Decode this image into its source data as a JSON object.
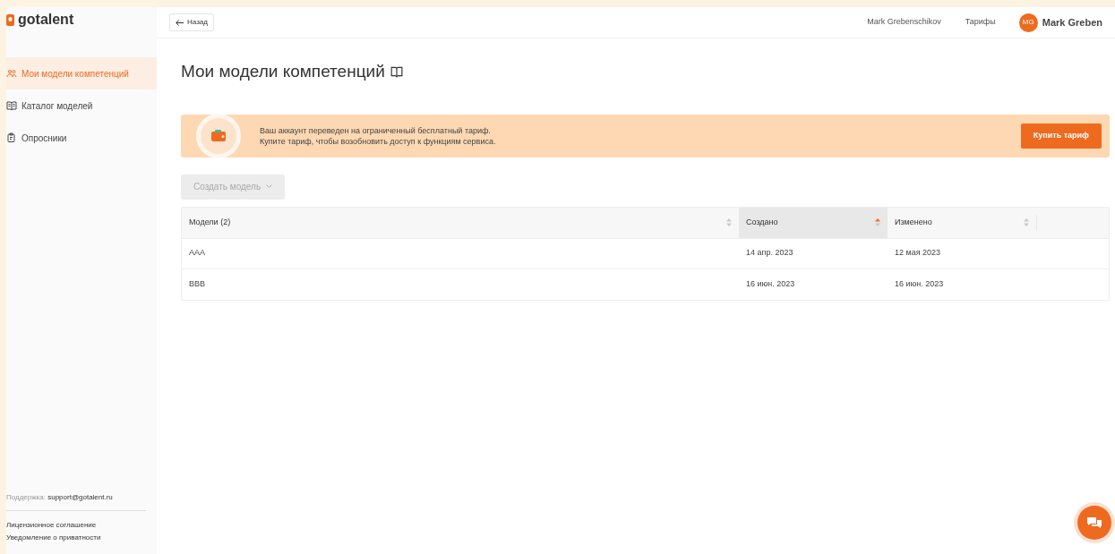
{
  "logo": {
    "text": "gotalent"
  },
  "sidebar": {
    "items": [
      {
        "label": "Мои модели компетенций",
        "selected": true,
        "kind": "people"
      },
      {
        "label": "Каталог моделей",
        "selected": false,
        "kind": "book"
      },
      {
        "label": "Опросники",
        "selected": false,
        "kind": "survey"
      }
    ],
    "support_label": "Поддержка:",
    "support_email": "support@gotalent.ru",
    "links": [
      "Лицензионное соглашение",
      "Уведомление о приватности"
    ]
  },
  "header": {
    "back": "Назад",
    "user_name": "Mark Grebenschikov",
    "tariffs": "Тарифы",
    "avatar_initials": "MG",
    "profile_name": "Mark Greben"
  },
  "page": {
    "title": "Мои модели компетенций"
  },
  "banner": {
    "lines": [
      "Ваш аккаунт переведен на ограниченный бесплатный тариф.",
      "Купите тариф, чтобы возобновить доступ к функциям сервиса."
    ],
    "button": "Купить тариф"
  },
  "create_button": {
    "label": "Создать модель",
    "disabled": true
  },
  "table": {
    "columns": [
      {
        "label": "Модели (2)",
        "sorted": false
      },
      {
        "label": "Создано",
        "sorted": true
      },
      {
        "label": "Изменено",
        "sorted": false
      }
    ],
    "rows": [
      [
        "AAA",
        "14 апр. 2023",
        "12 мая 2023"
      ],
      [
        "BBB",
        "16 июн. 2023",
        "16 июн. 2023"
      ]
    ]
  }
}
